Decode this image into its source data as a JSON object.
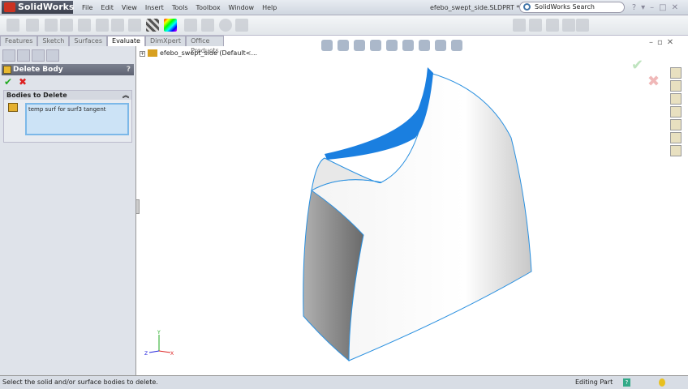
{
  "app": {
    "name": "SolidWorks",
    "document_title": "efebo_swept_side.SLDPRT *",
    "search_placeholder": "SolidWorks Search"
  },
  "menu": [
    "File",
    "Edit",
    "View",
    "Insert",
    "Tools",
    "Toolbox",
    "Window",
    "Help"
  ],
  "command_tabs": [
    {
      "label": "Features"
    },
    {
      "label": "Sketch"
    },
    {
      "label": "Surfaces"
    },
    {
      "label": "Evaluate",
      "active": true
    },
    {
      "label": "DimXpert"
    },
    {
      "label": "Office Products"
    }
  ],
  "property_manager": {
    "title": "Delete Body",
    "help": "?",
    "group_title": "Bodies to Delete",
    "selected_bodies": [
      "temp surf for surf3 tangent"
    ]
  },
  "feature_tree": {
    "root": "efebo_swept_side  (Default<..."
  },
  "status_bar": {
    "message": "Select the solid and/or surface bodies to delete.",
    "mode": "Editing Part"
  },
  "colors": {
    "selected_face": "#1a7fe0",
    "edge_highlight": "#2a90e0"
  }
}
